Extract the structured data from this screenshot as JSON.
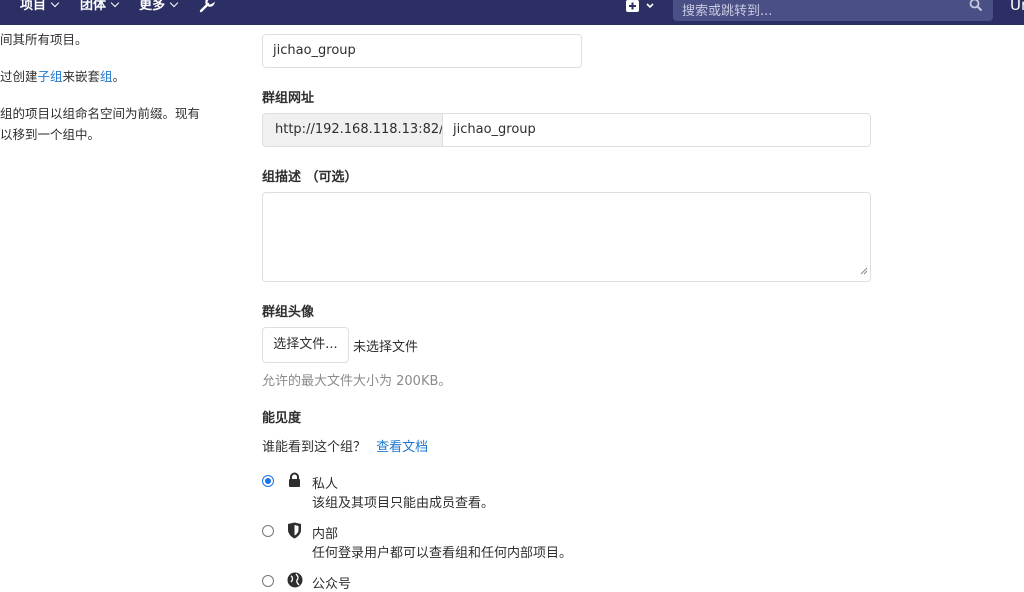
{
  "topbar": {
    "nav": [
      {
        "label": "项目"
      },
      {
        "label": "团体"
      },
      {
        "label": "更多"
      }
    ],
    "search_placeholder": "搜索或跳转到...",
    "avatar_text": "Ur"
  },
  "sidebar_help": {
    "line1": "间其所有项目。",
    "line2_prefix": "过创建",
    "line2_link1": "子组",
    "line2_mid": "来嵌套",
    "line2_link2": "组",
    "line2_suffix": "。",
    "line3": "组的项目以组命名空间为前缀。现有",
    "line4": "以移到一个组中。"
  },
  "form": {
    "group_name_value": "jichao_group",
    "url_label": "群组网址",
    "url_prefix": "http://192.168.118.13:82/",
    "url_path_value": "jichao_group",
    "description_label": "组描述 （可选）",
    "avatar_label": "群组头像",
    "file_button_label": "选择文件...",
    "file_none_text": "未选择文件",
    "file_hint": "允许的最大文件大小为 200KB。",
    "visibility_label": "能见度",
    "visibility_question": "谁能看到这个组？",
    "visibility_doc_link": "查看文档",
    "options": [
      {
        "label": "私人",
        "desc": "该组及其项目只能由成员查看。",
        "checked": true,
        "icon": "lock-icon"
      },
      {
        "label": "内部",
        "desc": "任何登录用户都可以查看组和任何内部项目。",
        "checked": false,
        "icon": "shield-icon"
      },
      {
        "label": "公众号",
        "desc": "",
        "checked": false,
        "icon": "globe-icon"
      }
    ]
  },
  "colors": {
    "topbar": "#2b2f63",
    "link": "#1f78d1",
    "radio_checked": "#1a73e8"
  }
}
